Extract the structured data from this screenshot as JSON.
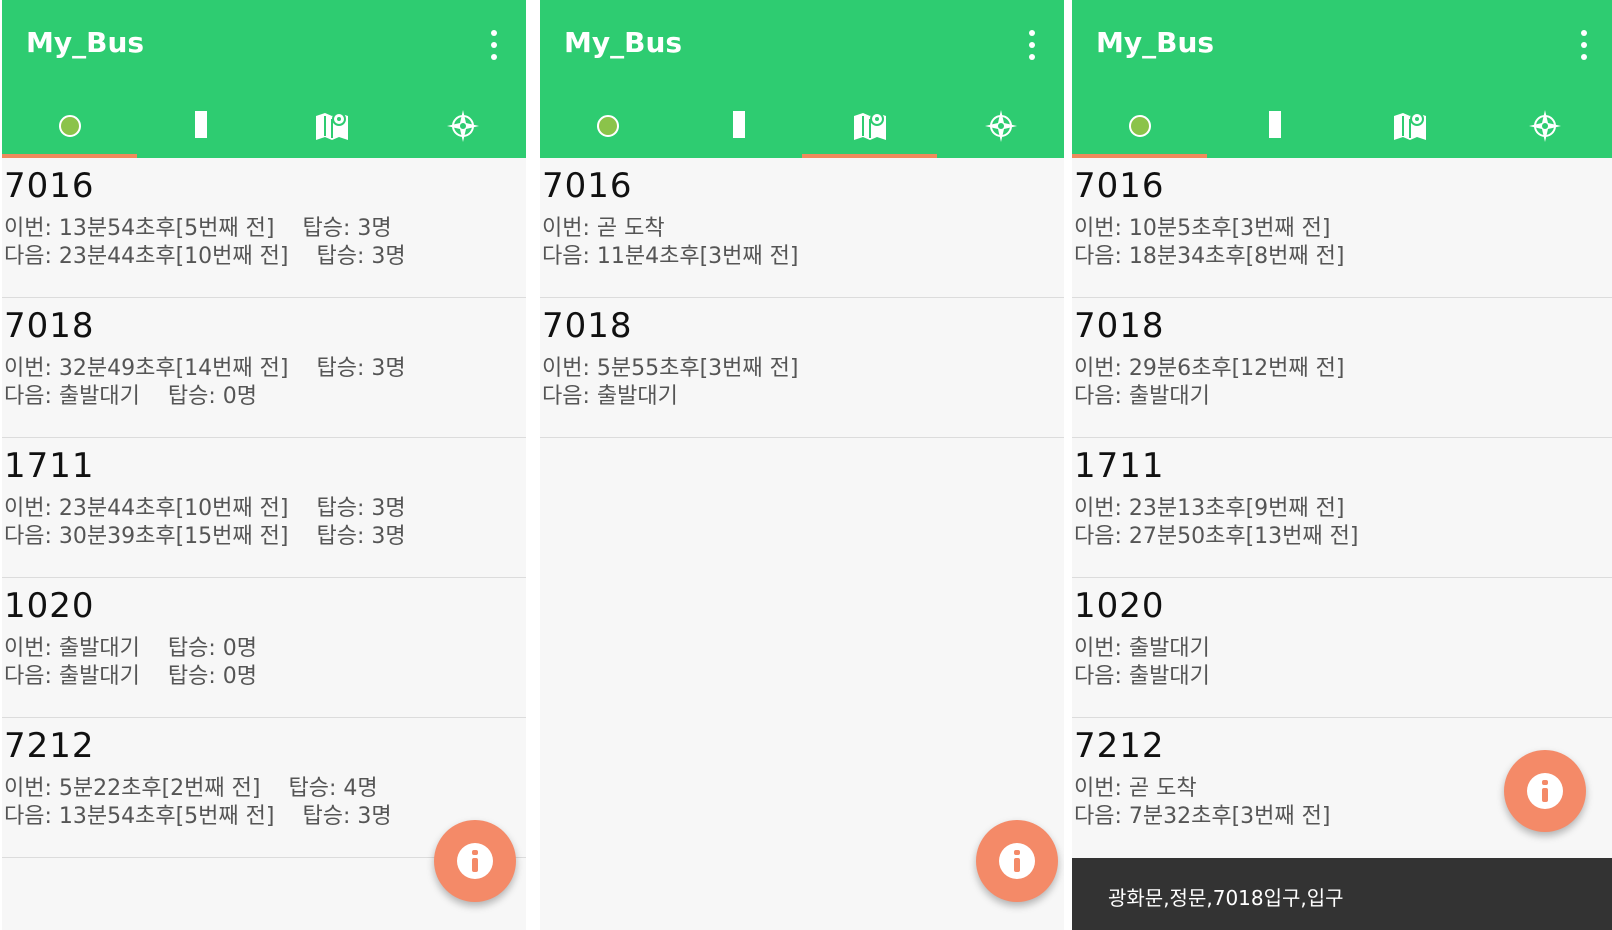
{
  "panels": [
    {
      "title": "My_Bus",
      "buses": [
        {
          "number": "7016",
          "line1": "이번: 13분54초후[5번째 전]",
          "board1": "탑승: 3명",
          "line2": "다음: 23분44초후[10번째 전]",
          "board2": "탑승: 3명"
        },
        {
          "number": "7018",
          "line1": "이번: 32분49초후[14번째 전]",
          "board1": "탑승: 3명",
          "line2": "다음: 출발대기",
          "board2": "탑승: 0명"
        },
        {
          "number": "1711",
          "line1": "이번: 23분44초후[10번째 전]",
          "board1": "탑승: 3명",
          "line2": "다음: 30분39초후[15번째 전]",
          "board2": "탑승: 3명"
        },
        {
          "number": "1020",
          "line1": "이번: 출발대기",
          "board1": "탑승: 0명",
          "line2": "다음: 출발대기",
          "board2": "탑승: 0명"
        },
        {
          "number": "7212",
          "line1": "이번: 5분22초후[2번째 전]",
          "board1": "탑승: 4명",
          "line2": "다음: 13분54초후[5번째 전]",
          "board2": "탑승: 3명"
        }
      ]
    },
    {
      "title": "My_Bus",
      "buses": [
        {
          "number": "7016",
          "line1": "이번: 곧 도착",
          "line2": "다음: 11분4초후[3번째 전]"
        },
        {
          "number": "7018",
          "line1": "이번: 5분55초후[3번째 전]",
          "line2": "다음: 출발대기"
        }
      ]
    },
    {
      "title": "My_Bus",
      "buses": [
        {
          "number": "7016",
          "line1": "이번: 10분5초후[3번째 전]",
          "line2": "다음: 18분34초후[8번째 전]"
        },
        {
          "number": "7018",
          "line1": "이번: 29분6초후[12번째 전]",
          "line2": "다음: 출발대기"
        },
        {
          "number": "1711",
          "line1": "이번: 23분13초후[9번째 전]",
          "line2": "다음: 27분50초후[13번째 전]"
        },
        {
          "number": "1020",
          "line1": "이번: 출발대기",
          "line2": "다음: 출발대기"
        },
        {
          "number": "7212",
          "line1": "이번: 곧 도착",
          "line2": "다음: 7분32초후[3번째 전]"
        }
      ],
      "snackbar": "광화문,정문,7018입구,입구"
    }
  ],
  "tabs": [
    "dot-icon",
    "bar-icon",
    "map-icon",
    "compass-icon"
  ],
  "colors": {
    "appbar": "#2ecc71",
    "indicator": "#f08a5d",
    "fab": "#f48a68",
    "dot": "#8bc34a"
  }
}
